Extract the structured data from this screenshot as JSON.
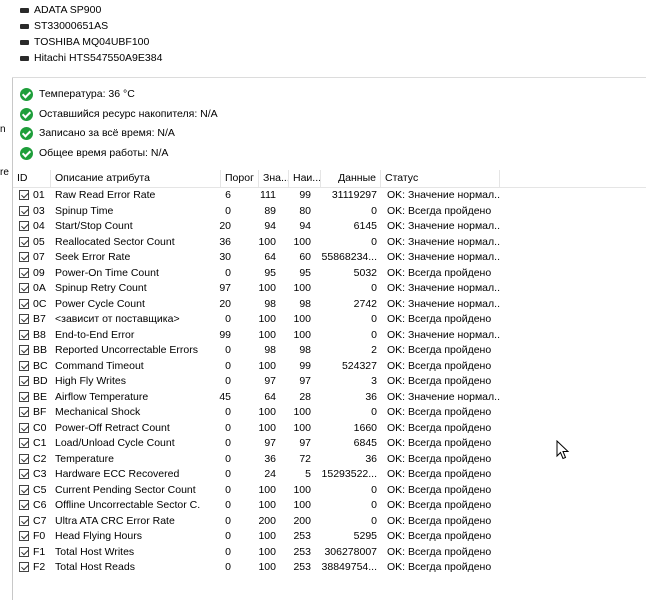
{
  "drives": [
    "ADATA SP900",
    "ST33000651AS",
    "TOSHIBA MQ04UBF100",
    "Hitachi HTS547550A9E384"
  ],
  "left_edge_fragments": [
    "n",
    "re"
  ],
  "summary": [
    "Температура: 36 °C",
    "Оставшийся ресурс накопителя: N/A",
    "Записано за всё время: N/A",
    "Общее время работы: N/A"
  ],
  "columns": [
    "ID",
    "Описание атрибута",
    "Порог",
    "Зна...",
    "Наи...",
    "Данные",
    "Статус"
  ],
  "rows": [
    {
      "id": "01",
      "name": "Raw Read Error Rate",
      "thr": "6",
      "val": "111",
      "worst": "99",
      "data": "31119297",
      "status": "OK: Значение нормал..."
    },
    {
      "id": "03",
      "name": "Spinup Time",
      "thr": "0",
      "val": "89",
      "worst": "80",
      "data": "0",
      "status": "OK: Всегда пройдено"
    },
    {
      "id": "04",
      "name": "Start/Stop Count",
      "thr": "20",
      "val": "94",
      "worst": "94",
      "data": "6145",
      "status": "OK: Значение нормал..."
    },
    {
      "id": "05",
      "name": "Reallocated Sector Count",
      "thr": "36",
      "val": "100",
      "worst": "100",
      "data": "0",
      "status": "OK: Значение нормал..."
    },
    {
      "id": "07",
      "name": "Seek Error Rate",
      "thr": "30",
      "val": "64",
      "worst": "60",
      "data": "55868234...",
      "status": "OK: Значение нормал..."
    },
    {
      "id": "09",
      "name": "Power-On Time Count",
      "thr": "0",
      "val": "95",
      "worst": "95",
      "data": "5032",
      "status": "OK: Всегда пройдено"
    },
    {
      "id": "0A",
      "name": "Spinup Retry Count",
      "thr": "97",
      "val": "100",
      "worst": "100",
      "data": "0",
      "status": "OK: Значение нормал..."
    },
    {
      "id": "0C",
      "name": "Power Cycle Count",
      "thr": "20",
      "val": "98",
      "worst": "98",
      "data": "2742",
      "status": "OK: Значение нормал..."
    },
    {
      "id": "B7",
      "name": "<зависит от поставщика>",
      "thr": "0",
      "val": "100",
      "worst": "100",
      "data": "0",
      "status": "OK: Всегда пройдено"
    },
    {
      "id": "B8",
      "name": "End-to-End Error",
      "thr": "99",
      "val": "100",
      "worst": "100",
      "data": "0",
      "status": "OK: Значение нормал..."
    },
    {
      "id": "BB",
      "name": "Reported Uncorrectable Errors",
      "thr": "0",
      "val": "98",
      "worst": "98",
      "data": "2",
      "status": "OK: Всегда пройдено"
    },
    {
      "id": "BC",
      "name": "Command Timeout",
      "thr": "0",
      "val": "100",
      "worst": "99",
      "data": "524327",
      "status": "OK: Всегда пройдено"
    },
    {
      "id": "BD",
      "name": "High Fly Writes",
      "thr": "0",
      "val": "97",
      "worst": "97",
      "data": "3",
      "status": "OK: Всегда пройдено"
    },
    {
      "id": "BE",
      "name": "Airflow Temperature",
      "thr": "45",
      "val": "64",
      "worst": "28",
      "data": "36",
      "status": "OK: Значение нормал..."
    },
    {
      "id": "BF",
      "name": "Mechanical Shock",
      "thr": "0",
      "val": "100",
      "worst": "100",
      "data": "0",
      "status": "OK: Всегда пройдено"
    },
    {
      "id": "C0",
      "name": "Power-Off Retract Count",
      "thr": "0",
      "val": "100",
      "worst": "100",
      "data": "1660",
      "status": "OK: Всегда пройдено"
    },
    {
      "id": "C1",
      "name": "Load/Unload Cycle Count",
      "thr": "0",
      "val": "97",
      "worst": "97",
      "data": "6845",
      "status": "OK: Всегда пройдено"
    },
    {
      "id": "C2",
      "name": "Temperature",
      "thr": "0",
      "val": "36",
      "worst": "72",
      "data": "36",
      "status": "OK: Всегда пройдено"
    },
    {
      "id": "C3",
      "name": "Hardware ECC Recovered",
      "thr": "0",
      "val": "24",
      "worst": "5",
      "data": "15293522...",
      "status": "OK: Всегда пройдено"
    },
    {
      "id": "C5",
      "name": "Current Pending Sector Count",
      "thr": "0",
      "val": "100",
      "worst": "100",
      "data": "0",
      "status": "OK: Всегда пройдено"
    },
    {
      "id": "C6",
      "name": "Offline Uncorrectable Sector C...",
      "thr": "0",
      "val": "100",
      "worst": "100",
      "data": "0",
      "status": "OK: Всегда пройдено"
    },
    {
      "id": "C7",
      "name": "Ultra ATA CRC Error Rate",
      "thr": "0",
      "val": "200",
      "worst": "200",
      "data": "0",
      "status": "OK: Всегда пройдено"
    },
    {
      "id": "F0",
      "name": "Head Flying Hours",
      "thr": "0",
      "val": "100",
      "worst": "253",
      "data": "5295",
      "status": "OK: Всегда пройдено"
    },
    {
      "id": "F1",
      "name": "Total Host Writes",
      "thr": "0",
      "val": "100",
      "worst": "253",
      "data": "306278007",
      "status": "OK: Всегда пройдено"
    },
    {
      "id": "F2",
      "name": "Total Host Reads",
      "thr": "0",
      "val": "100",
      "worst": "253",
      "data": "38849754...",
      "status": "OK: Всегда пройдено"
    }
  ]
}
